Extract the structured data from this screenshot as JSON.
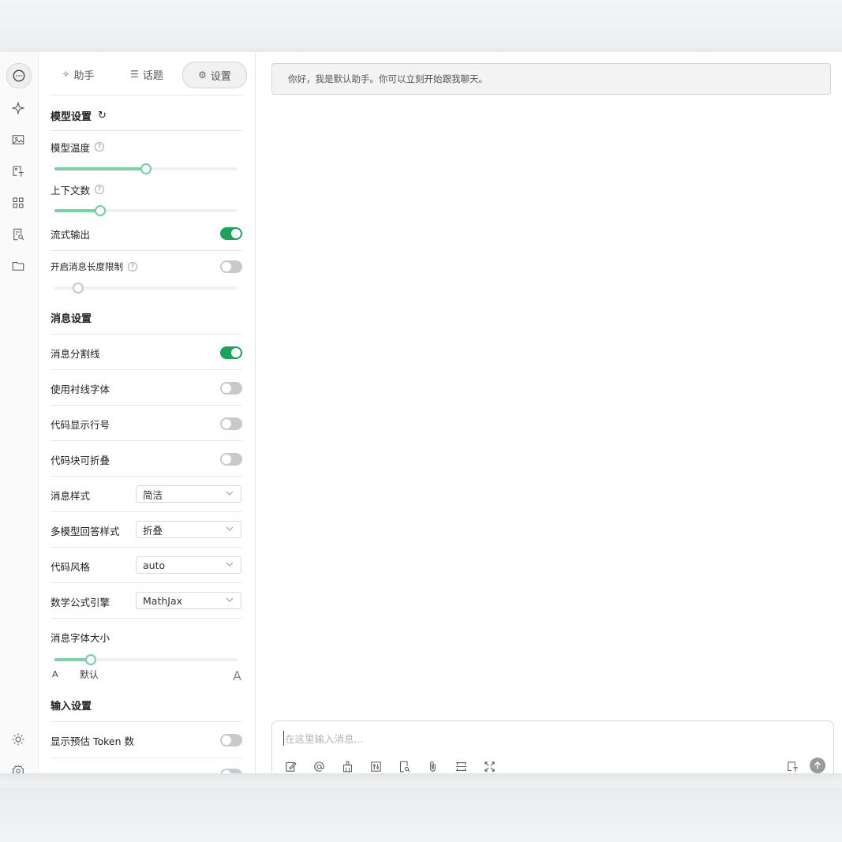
{
  "tabs": [
    {
      "label": "助手",
      "icon": "sparkle-icon"
    },
    {
      "label": "话题",
      "icon": "list-icon"
    },
    {
      "label": "设置",
      "icon": "gear-icon"
    }
  ],
  "model_settings": {
    "title": "模型设置",
    "temperature_label": "模型温度",
    "temperature_value": 0.5,
    "context_label": "上下文数",
    "context_value": 0.25,
    "stream_label": "流式输出",
    "stream_on": true,
    "length_limit_label": "开启消息长度限制",
    "length_limit_on": false,
    "length_limit_value": 0.13
  },
  "message_settings": {
    "title": "消息设置",
    "divider_label": "消息分割线",
    "divider_on": true,
    "serif_label": "使用衬线字体",
    "serif_on": false,
    "line_numbers_label": "代码显示行号",
    "line_numbers_on": false,
    "collapsible_label": "代码块可折叠",
    "collapsible_on": false,
    "style_label": "消息样式",
    "style_value": "简洁",
    "multi_model_label": "多模型回答样式",
    "multi_model_value": "折叠",
    "code_style_label": "代码风格",
    "code_style_value": "auto",
    "math_engine_label": "数学公式引擎",
    "math_engine_value": "MathJax",
    "font_size_label": "消息字体大小",
    "font_size_value": 0.2,
    "font_small": "A",
    "font_default": "默认",
    "font_large": "A"
  },
  "input_settings": {
    "title": "输入设置",
    "token_label": "显示预估 Token 数",
    "token_on": false
  },
  "chat": {
    "greeting": "你好，我是默认助手。你可以立刻开始跟我聊天。",
    "input_placeholder": "在这里输入消息..."
  },
  "colors": {
    "accent": "#1aa35a",
    "slider_fill": "#7ad3a4"
  }
}
